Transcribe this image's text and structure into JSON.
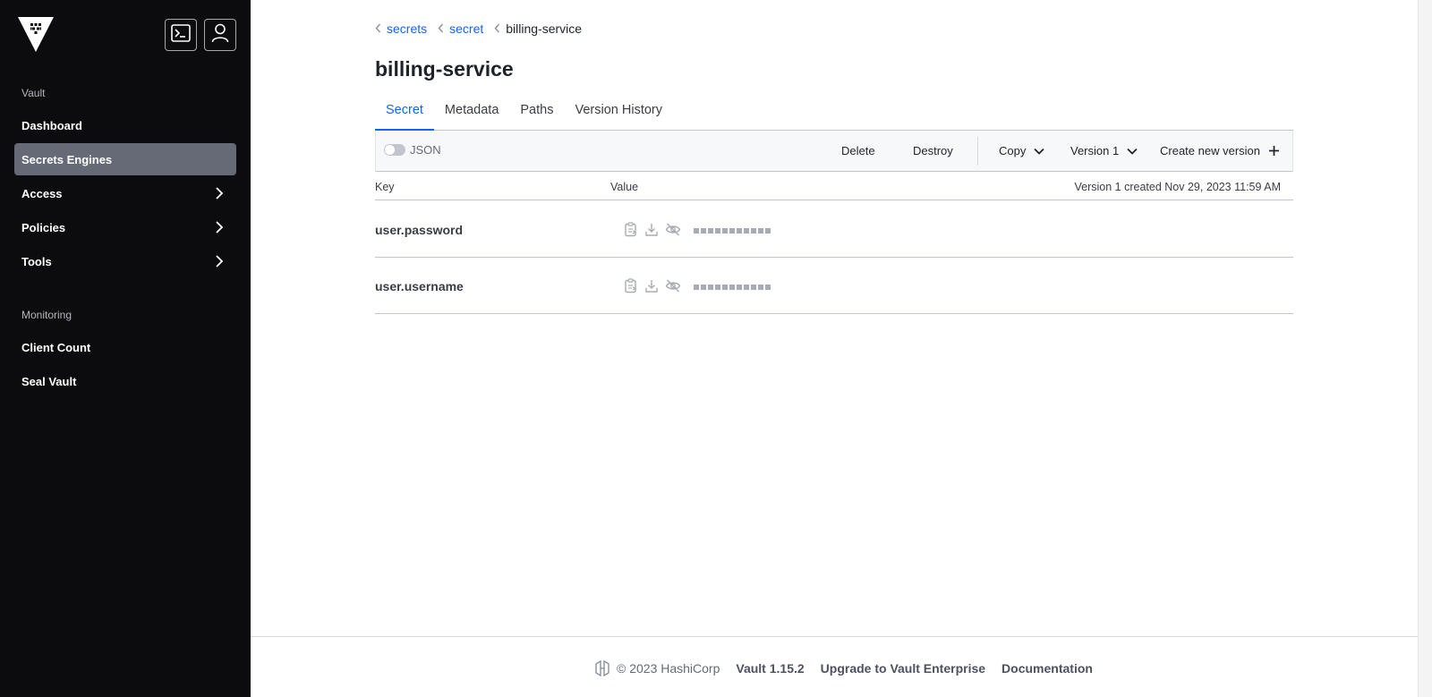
{
  "sidebar": {
    "logo_icon": "vault-logo-icon",
    "console_icon": "terminal-icon",
    "user_icon": "user-icon",
    "sections": [
      {
        "heading": "Vault"
      },
      {
        "heading": "Monitoring"
      }
    ],
    "items": [
      {
        "label": "Dashboard"
      },
      {
        "label": "Secrets Engines",
        "active": true
      },
      {
        "label": "Access"
      },
      {
        "label": "Policies"
      },
      {
        "label": "Tools"
      },
      {
        "label": "Client Count"
      },
      {
        "label": "Seal Vault"
      }
    ]
  },
  "breadcrumb": [
    {
      "label": "secrets"
    },
    {
      "label": "secret"
    },
    {
      "label": "billing-service"
    }
  ],
  "page": {
    "title": "billing-service"
  },
  "tabs": [
    {
      "label": "Secret",
      "active": true
    },
    {
      "label": "Metadata"
    },
    {
      "label": "Paths"
    },
    {
      "label": "Version History"
    }
  ],
  "toolbar": {
    "json_label": "JSON",
    "json_toggle_on": false,
    "delete_label": "Delete",
    "destroy_label": "Destroy",
    "copy_label": "Copy",
    "version_label": "Version 1",
    "create_label": "Create new version"
  },
  "table": {
    "headers": {
      "key": "Key",
      "value": "Value"
    },
    "version_info": "Version 1 created Nov 29, 2023 11:59 AM",
    "rows": [
      {
        "key": "user.password",
        "value_masked": true
      },
      {
        "key": "user.username",
        "value_masked": true
      }
    ]
  },
  "footer": {
    "copyright": "© 2023 HashiCorp",
    "version": "Vault 1.15.2",
    "upgrade": "Upgrade to Vault Enterprise",
    "docs": "Documentation"
  },
  "colors": {
    "sidebar_bg": "#0c0c0e",
    "active_nav": "#656a76",
    "link": "#1563ff"
  }
}
